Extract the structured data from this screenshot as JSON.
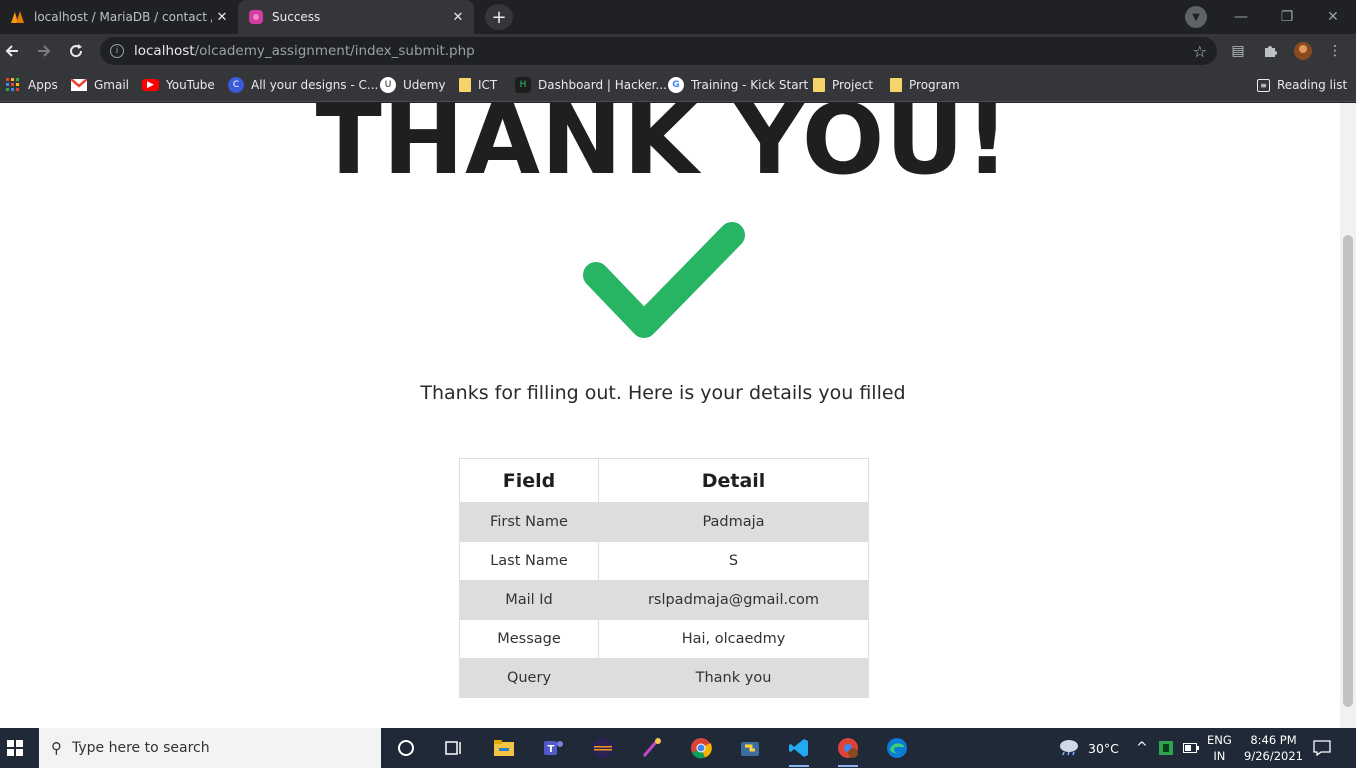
{
  "browser": {
    "tabs": [
      {
        "title": "localhost / MariaDB / contact / d",
        "favicon": "phpmyadmin-icon",
        "active": false
      },
      {
        "title": "Success",
        "favicon": "site-favicon",
        "active": true
      }
    ],
    "address": {
      "host": "localhost",
      "path": "/olcademy_assignment/index_submit.php"
    },
    "bookmarks": [
      {
        "label": "Apps",
        "icon": "apps-grid-icon"
      },
      {
        "label": "Gmail",
        "icon": "gmail-icon"
      },
      {
        "label": "YouTube",
        "icon": "youtube-icon"
      },
      {
        "label": "All your designs - C...",
        "icon": "canva-icon"
      },
      {
        "label": "Udemy",
        "icon": "udemy-icon"
      },
      {
        "label": "ICT",
        "icon": "folder-icon"
      },
      {
        "label": "Dashboard | Hacker...",
        "icon": "hackerrank-icon"
      },
      {
        "label": "Training - Kick Start",
        "icon": "google-icon"
      },
      {
        "label": "Project",
        "icon": "folder-icon"
      },
      {
        "label": "Program",
        "icon": "folder-icon"
      }
    ],
    "reading_list": "Reading list"
  },
  "page": {
    "title": "THANK YOU!",
    "subtitle": "Thanks for filling out. Here is your details you filled",
    "check_color": "#27b463",
    "table": {
      "headers": [
        "Field",
        "Detail"
      ],
      "rows": [
        [
          "First Name",
          "Padmaja"
        ],
        [
          "Last Name",
          "S"
        ],
        [
          "Mail Id",
          "rslpadmaja@gmail.com"
        ],
        [
          "Message",
          "Hai, olcaedmy"
        ],
        [
          "Query",
          "Thank you"
        ]
      ]
    }
  },
  "taskbar": {
    "search_placeholder": "Type here to search",
    "weather": "30°C",
    "language": "ENG",
    "region": "IN",
    "time": "8:46 PM",
    "date": "9/26/2021"
  }
}
